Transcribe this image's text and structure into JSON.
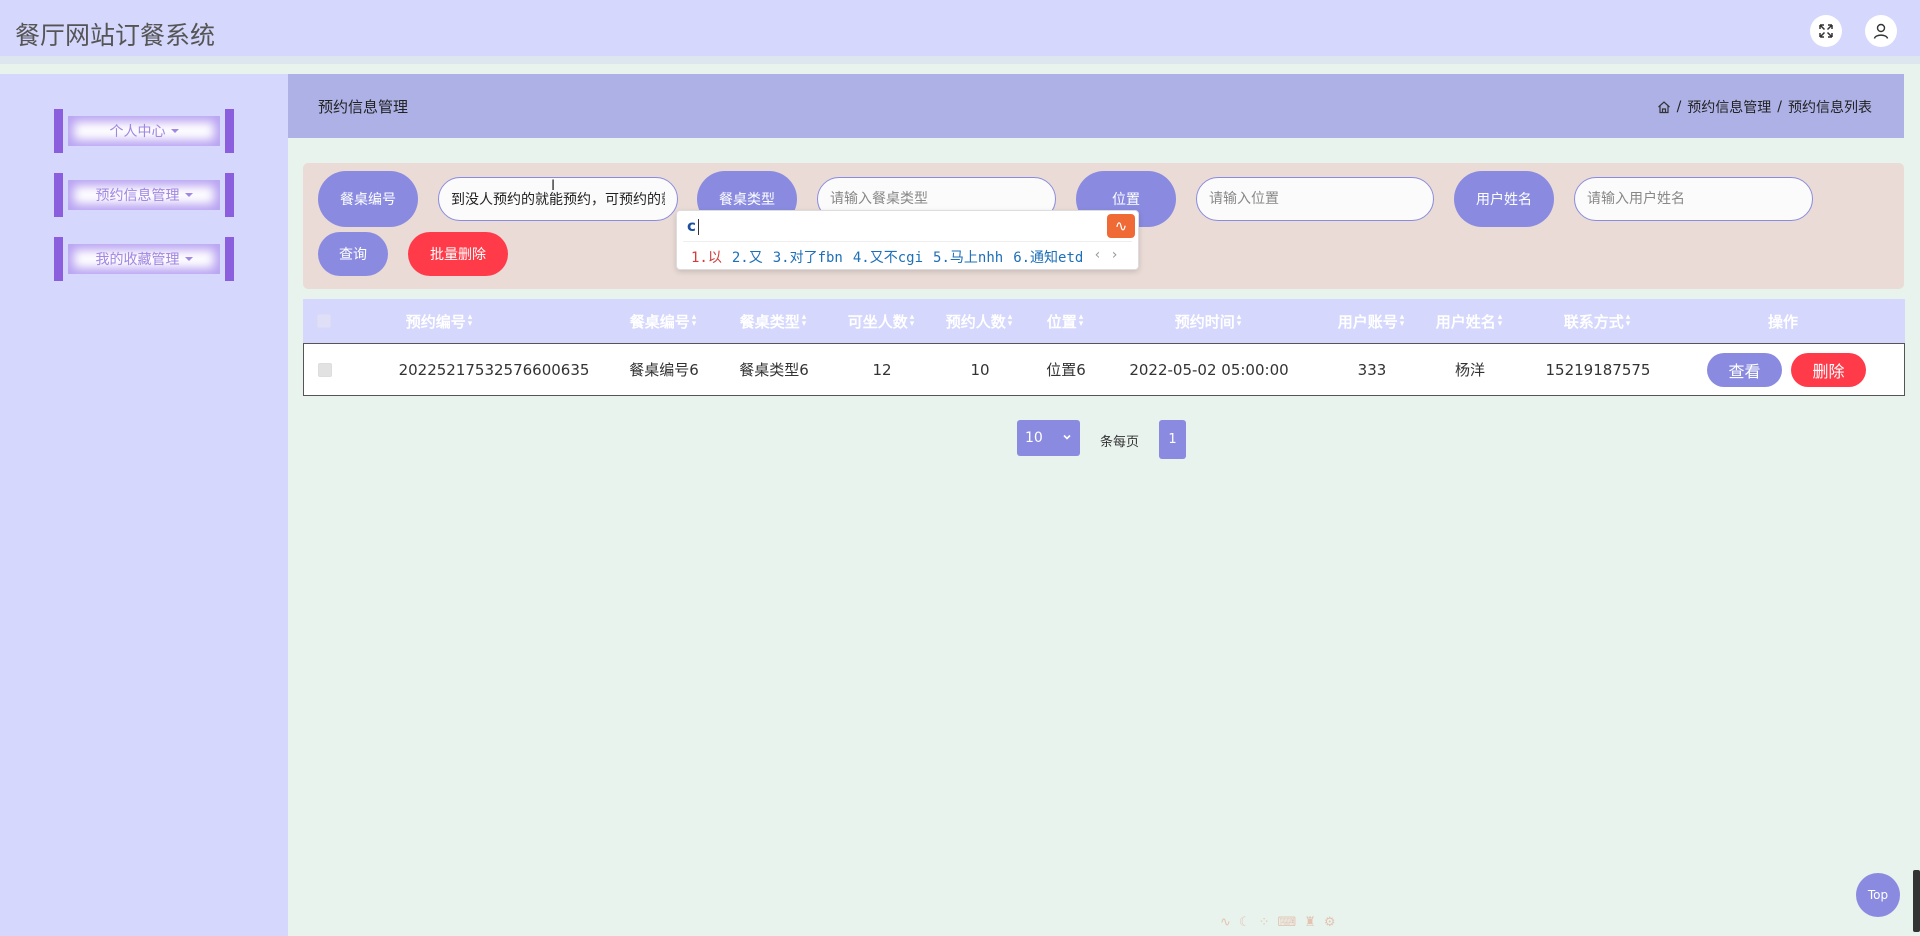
{
  "app": {
    "title": "餐厅网站订餐系统"
  },
  "sidebar": {
    "items": [
      {
        "label": "个人中心"
      },
      {
        "label": "预约信息管理"
      },
      {
        "label": "我的收藏管理"
      }
    ]
  },
  "header": {
    "page_title": "预约信息管理",
    "breadcrumb": [
      "预约信息管理",
      "预约信息列表"
    ],
    "breadcrumb_sep": "/"
  },
  "search": {
    "labels": {
      "table_no": "餐桌编号",
      "table_type": "餐桌类型",
      "location": "位置",
      "user_name": "用户姓名"
    },
    "table_no_value": "到没人预约的就能预约，可预约的就",
    "table_type_placeholder": "请输入餐桌类型",
    "location_placeholder": "请输入位置",
    "user_name_placeholder": "请输入用户姓名",
    "query_label": "查询",
    "batch_delete_label": "批量删除"
  },
  "ime": {
    "typed": "c",
    "candidates": [
      "1.以",
      "2.又",
      "3.对了fbn",
      "4.又不cgi",
      "5.马上nhh",
      "6.通知etd"
    ],
    "nav": "‹ ›"
  },
  "table": {
    "columns": [
      "预约编号",
      "餐桌编号",
      "餐桌类型",
      "可坐人数",
      "预约人数",
      "位置",
      "预约时间",
      "用户账号",
      "用户姓名",
      "联系方式",
      "操作"
    ],
    "rows": [
      {
        "booking_no": "20225217532576600635",
        "table_no": "餐桌编号6",
        "table_type": "餐桌类型6",
        "capacity": "12",
        "reserved": "10",
        "location": "位置6",
        "time": "2022-05-02 05:00:00",
        "account": "333",
        "user_name": "杨洋",
        "phone": "15219187575",
        "view_label": "查看",
        "delete_label": "删除"
      }
    ]
  },
  "pagination": {
    "page_size": "10",
    "per_page_text": "条每页",
    "current_page": "1"
  },
  "back_to_top": "Top",
  "colors": {
    "accent": "#8a8be0",
    "danger": "#ff3b4a",
    "header_bg": "#d5d7fd"
  }
}
